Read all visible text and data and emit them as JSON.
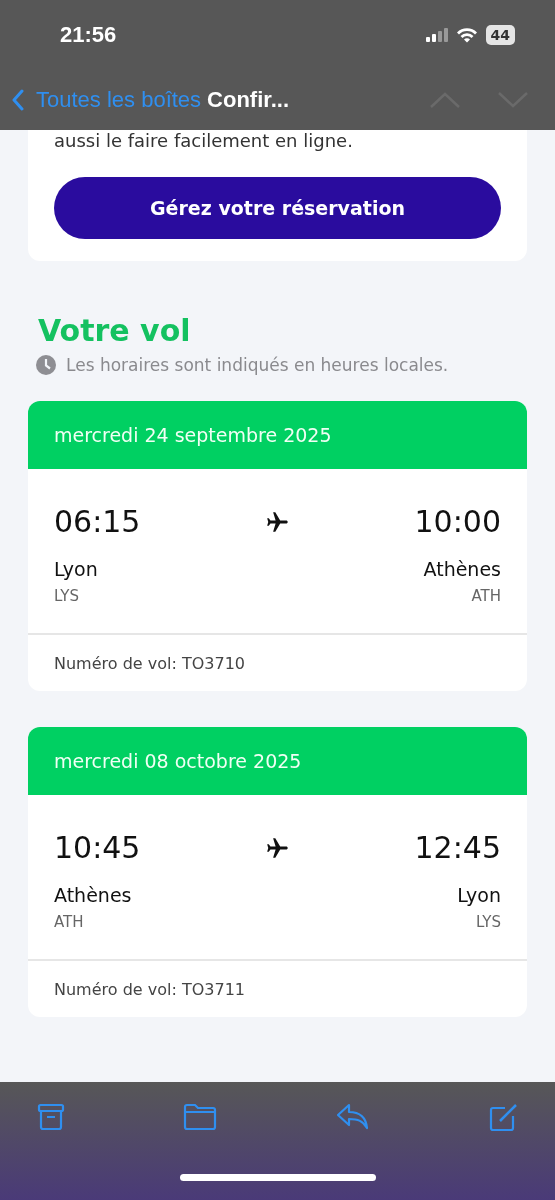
{
  "status_bar": {
    "time": "21:56",
    "battery": "44"
  },
  "nav": {
    "back": "Toutes les boîtes",
    "title": "Confir...",
    "arrows_disabled": true
  },
  "intro": {
    "text": "aussi le faire facilement en ligne.",
    "button": "Gérez votre réservation"
  },
  "section": {
    "title": "Votre vol",
    "note": "Les horaires sont indiqués en heures locales."
  },
  "flights": [
    {
      "date": "mercredi 24 septembre 2025",
      "dep_time": "06:15",
      "dep_city": "Lyon",
      "dep_code": "LYS",
      "arr_time": "10:00",
      "arr_city": "Athènes",
      "arr_code": "ATH",
      "flight_no": "Numéro de vol: TO3710"
    },
    {
      "date": "mercredi 08 octobre 2025",
      "dep_time": "10:45",
      "dep_city": "Athènes",
      "dep_code": "ATH",
      "arr_time": "12:45",
      "arr_city": "Lyon",
      "arr_code": "LYS",
      "flight_no": "Numéro de vol: TO3711"
    }
  ]
}
